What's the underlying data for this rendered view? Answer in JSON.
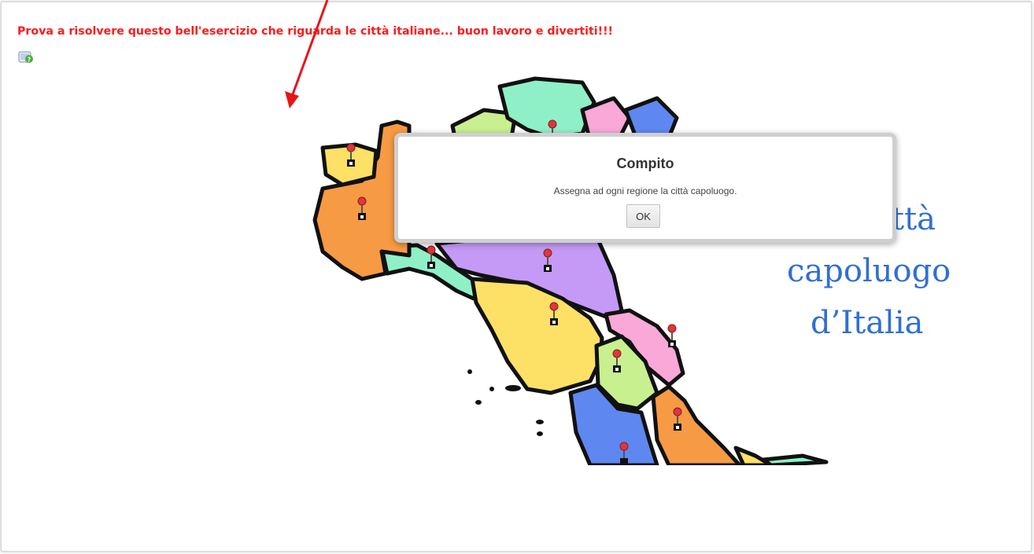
{
  "intro_text": "Prova a risolvere questo bell'esercizio che riguarda le città italiane... buon lavoro e divertiti!!!",
  "title_lines": [
    "ttà",
    "capoluogo",
    "d’Italia"
  ],
  "dialog": {
    "title": "Compito",
    "message": "Assegna ad ogni regione la città capoluogo.",
    "ok_label": "OK"
  },
  "colors": {
    "intro": "#ff1a1a",
    "title": "#2f6fd6",
    "arrow": "#e8141a",
    "pin": "#e0363c"
  },
  "icons": [
    "help-icon",
    "map-pin-icon"
  ]
}
